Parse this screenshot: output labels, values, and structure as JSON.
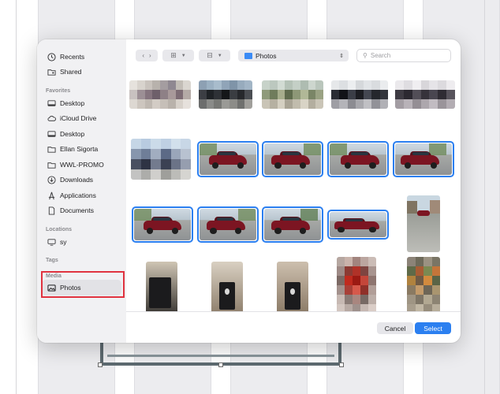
{
  "sidebar": {
    "top_items": [
      {
        "label": "Recents",
        "icon": "clock-icon"
      },
      {
        "label": "Shared",
        "icon": "shared-folder-icon"
      }
    ],
    "favorites_heading": "Favorites",
    "favorites": [
      {
        "label": "Desktop",
        "icon": "desktop-icon"
      },
      {
        "label": "iCloud Drive",
        "icon": "cloud-icon"
      },
      {
        "label": "Desktop",
        "icon": "desktop-icon"
      },
      {
        "label": "Ellan Sigorta",
        "icon": "folder-icon"
      },
      {
        "label": "WWL-PROMO",
        "icon": "folder-icon"
      },
      {
        "label": "Downloads",
        "icon": "download-icon"
      },
      {
        "label": "Applications",
        "icon": "applications-icon"
      },
      {
        "label": "Documents",
        "icon": "document-icon"
      }
    ],
    "locations_heading": "Locations",
    "locations": [
      {
        "label": "sy",
        "icon": "computer-icon"
      }
    ],
    "tags_heading": "Tags",
    "media_heading": "Media",
    "media": [
      {
        "label": "Photos",
        "icon": "photo-icon"
      }
    ]
  },
  "toolbar": {
    "back_icon": "chevron-left-icon",
    "forward_icon": "chevron-right-icon",
    "location": "Photos",
    "search_placeholder": "Search"
  },
  "footer": {
    "cancel_label": "Cancel",
    "select_label": "Select"
  },
  "colors": {
    "accent": "#2b7ff0",
    "highlight": "#e0333f",
    "car": "#7c1522"
  }
}
